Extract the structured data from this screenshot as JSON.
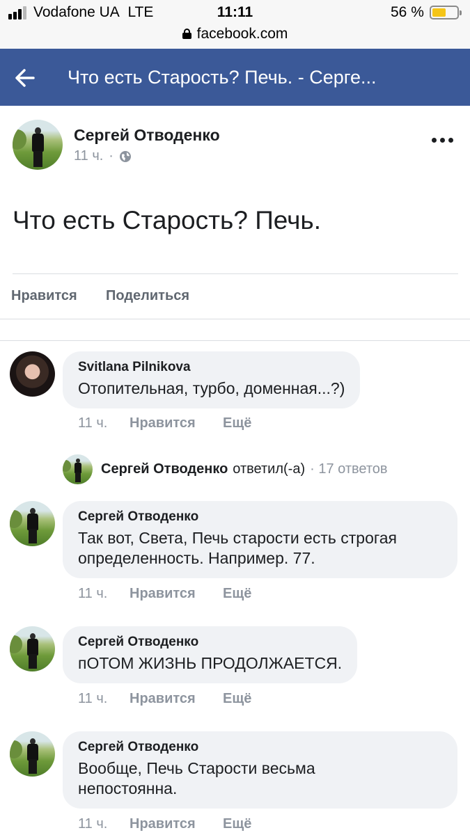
{
  "status_bar": {
    "carrier": "Vodafone UA",
    "network": "LTE",
    "time": "11:11",
    "battery_percent": "56 %",
    "battery_level": 0.56,
    "url": "facebook.com"
  },
  "header": {
    "title": "Что есть Старость? Печь. - Серге..."
  },
  "post": {
    "author": "Сергей Отводенко",
    "time": "11 ч.",
    "dot": "·",
    "audience_icon": "globe-icon",
    "text": "Что есть Старость? Печь.",
    "actions": {
      "like": "Нравится",
      "share": "Поделиться"
    }
  },
  "comments": [
    {
      "author": "Svitlana Pilnikova",
      "text": "Отопительная, турбо, доменная...?)",
      "time": "11 ч.",
      "like": "Нравится",
      "more": "Ещё"
    },
    {
      "author": "Сергей Отводенко",
      "text": "Так вот, Света, Печь старости есть строгая\nопределенность. Например. 77.",
      "time": "11 ч.",
      "like": "Нравится",
      "more": "Ещё"
    },
    {
      "author": "Сергей Отводенко",
      "text": "пОТОМ ЖИЗНЬ ПРОДОЛЖАЕТСЯ.",
      "time": "11 ч.",
      "like": "Нравится",
      "more": "Ещё"
    },
    {
      "author": "Сергей Отводенко",
      "text": "Вообще, Печь Старости весьма\nнепостоянна.",
      "time": "11 ч.",
      "like": "Нравится",
      "more": "Ещё"
    }
  ],
  "reply_summary": {
    "author": "Сергей Отводенко",
    "verb": "ответил(-а)",
    "count": "· 17 ответов"
  },
  "colors": {
    "header_bg": "#3b5998",
    "bubble_bg": "#f0f2f5",
    "meta_text": "#8d949e",
    "battery": "#f5c518"
  }
}
